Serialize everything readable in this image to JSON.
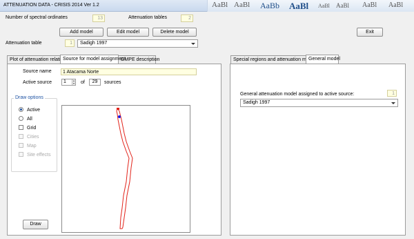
{
  "window": {
    "title": "ATTENUATION DATA - CRISIS 2014 Ver 1.2"
  },
  "background_text": [
    "AaBl",
    "AaBl",
    "AaBb",
    "AaBl",
    "AaBl",
    "AaBl",
    "AaBl",
    "AaBl"
  ],
  "header": {
    "spectral_label": "Number of spectral ordinates",
    "spectral_value": "13",
    "attn_tables_label": "Attenuation tables",
    "attn_tables_value": "2",
    "add_model": "Add model",
    "edit_model": "Edit model",
    "delete_model": "Delete model",
    "exit": "Exit",
    "attn_table_label": "Attenuation table",
    "attn_table_value": "1",
    "attn_table_combo": "Sadigh 1997"
  },
  "left_tabs": {
    "tabs": [
      "Plot of attenuation relation",
      "Source for model assignment",
      "GMPE description"
    ],
    "active": 1
  },
  "source_panel": {
    "source_name_label": "Source name",
    "source_name_value": "1 Atacama Norte",
    "active_source_label": "Active source",
    "active_source_value": "1",
    "of_label": "of",
    "sources_count": "29",
    "sources_label": "sources",
    "draw_options": {
      "title": "Draw options",
      "options": [
        {
          "label": "Active",
          "type": "radio",
          "checked": true,
          "enabled": true
        },
        {
          "label": "All",
          "type": "radio",
          "checked": false,
          "enabled": true
        },
        {
          "label": "Grid",
          "type": "checkbox",
          "checked": false,
          "enabled": true
        },
        {
          "label": "Cities",
          "type": "checkbox",
          "checked": false,
          "enabled": false
        },
        {
          "label": "Map",
          "type": "checkbox",
          "checked": false,
          "enabled": false
        },
        {
          "label": "Site effects",
          "type": "checkbox",
          "checked": false,
          "enabled": false
        }
      ]
    },
    "draw_button": "Draw",
    "colors": {
      "source_outline": "#e2231a",
      "vertex": "#1a1ae6"
    }
  },
  "right_tabs": {
    "tabs": [
      "Special regions and attenuation models",
      "General model"
    ],
    "active": 1
  },
  "general_model": {
    "label": "General attenuation model assigned to active source:",
    "value": "1",
    "combo": "Sadigh 1997"
  }
}
